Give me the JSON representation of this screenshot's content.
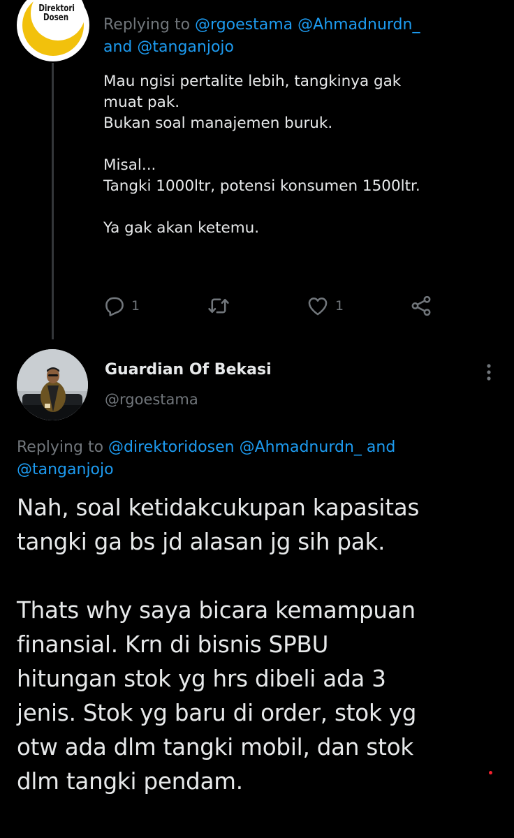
{
  "reply_tweet": {
    "avatar_logo_text": "Direktori Dosen",
    "replying_prefix": "Replying to",
    "mention_1": "@rgoestama",
    "mention_2": "@Ahmadnurdn_",
    "joiner": "and",
    "mention_3": "@tanganjojo",
    "body": "Mau ngisi pertalite lebih, tangkinya gak\nmuat pak.\nBukan soal manajemen buruk.\n\nMisal...\nTangki 1000ltr, potensi konsumen 1500ltr.\n\nYa gak akan ketemu.",
    "actions": {
      "reply_count": "1",
      "retweet_count": "",
      "like_count": "1"
    }
  },
  "main_tweet": {
    "display_name": "Guardian Of Bekasi",
    "handle": "@rgoestama",
    "replying_prefix": "Replying to",
    "mention_1": "@direktoridosen",
    "mention_2": "@Ahmadnurdn_",
    "joiner": "and",
    "mention_3": "@tanganjojo",
    "body": "Nah, soal ketidakcukupan kapasitas\ntangki ga bs jd alasan jg sih pak.\n\nThats why saya bicara kemampuan\nfinansial. Krn di bisnis SPBU\nhitungan stok yg hrs dibeli ada 3\njenis. Stok yg baru di order, stok yg\notw ada dlm tangki mobil, dan stok\ndlm tangki pendam."
  },
  "colors": {
    "background": "#000000",
    "text": "#e7e9ea",
    "muted": "#71767b",
    "link": "#1d9bf0",
    "logo_yellow": "#f2c10c"
  },
  "icons": [
    "reply-icon",
    "retweet-icon",
    "like-icon",
    "share-icon",
    "more-icon"
  ]
}
